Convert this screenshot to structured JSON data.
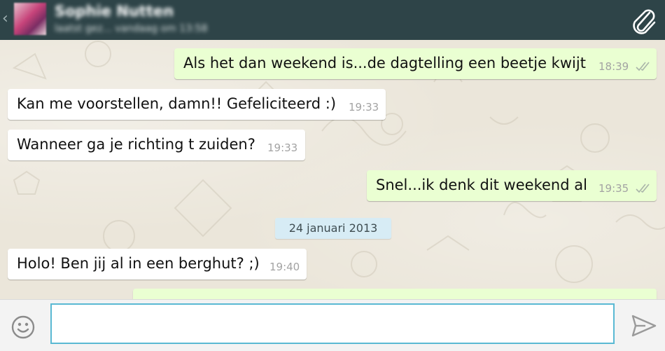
{
  "header": {
    "back_glyph": "‹",
    "contact_name": "Sophie Nutten",
    "contact_status": "laatst gez... vandaag om 13:58"
  },
  "messages": [
    {
      "direction": "out",
      "text": "Als het dan weekend is...de dagtelling een beetje kwijt",
      "time": "18:39",
      "ticks": "read"
    },
    {
      "direction": "in",
      "text": "Kan me voorstellen, damn!! Gefeliciteerd :)",
      "time": "19:33"
    },
    {
      "direction": "in",
      "text": "Wanneer ga je richting t zuiden?",
      "time": "19:33"
    },
    {
      "direction": "out",
      "text": "Snel...ik denk dit weekend al",
      "time": "19:35",
      "ticks": "read"
    },
    {
      "direction": "in",
      "text": "Holo! Ben jij al in een berghut? ;)",
      "time": "19:40"
    }
  ],
  "date_separator": "24 januari 2013",
  "composer": {
    "value": "",
    "placeholder": ""
  },
  "colors": {
    "header_bg": "#2e4448",
    "outgoing_bubble": "#eaffd2",
    "incoming_bubble": "#ffffff",
    "input_border": "#5ab9d3",
    "date_chip": "#d7ecf5"
  },
  "icons": {
    "back": "chevron-left-icon",
    "attach": "paperclip-icon",
    "emoji": "smiley-icon",
    "send": "send-arrow-icon",
    "ticks": "double-check-icon"
  }
}
